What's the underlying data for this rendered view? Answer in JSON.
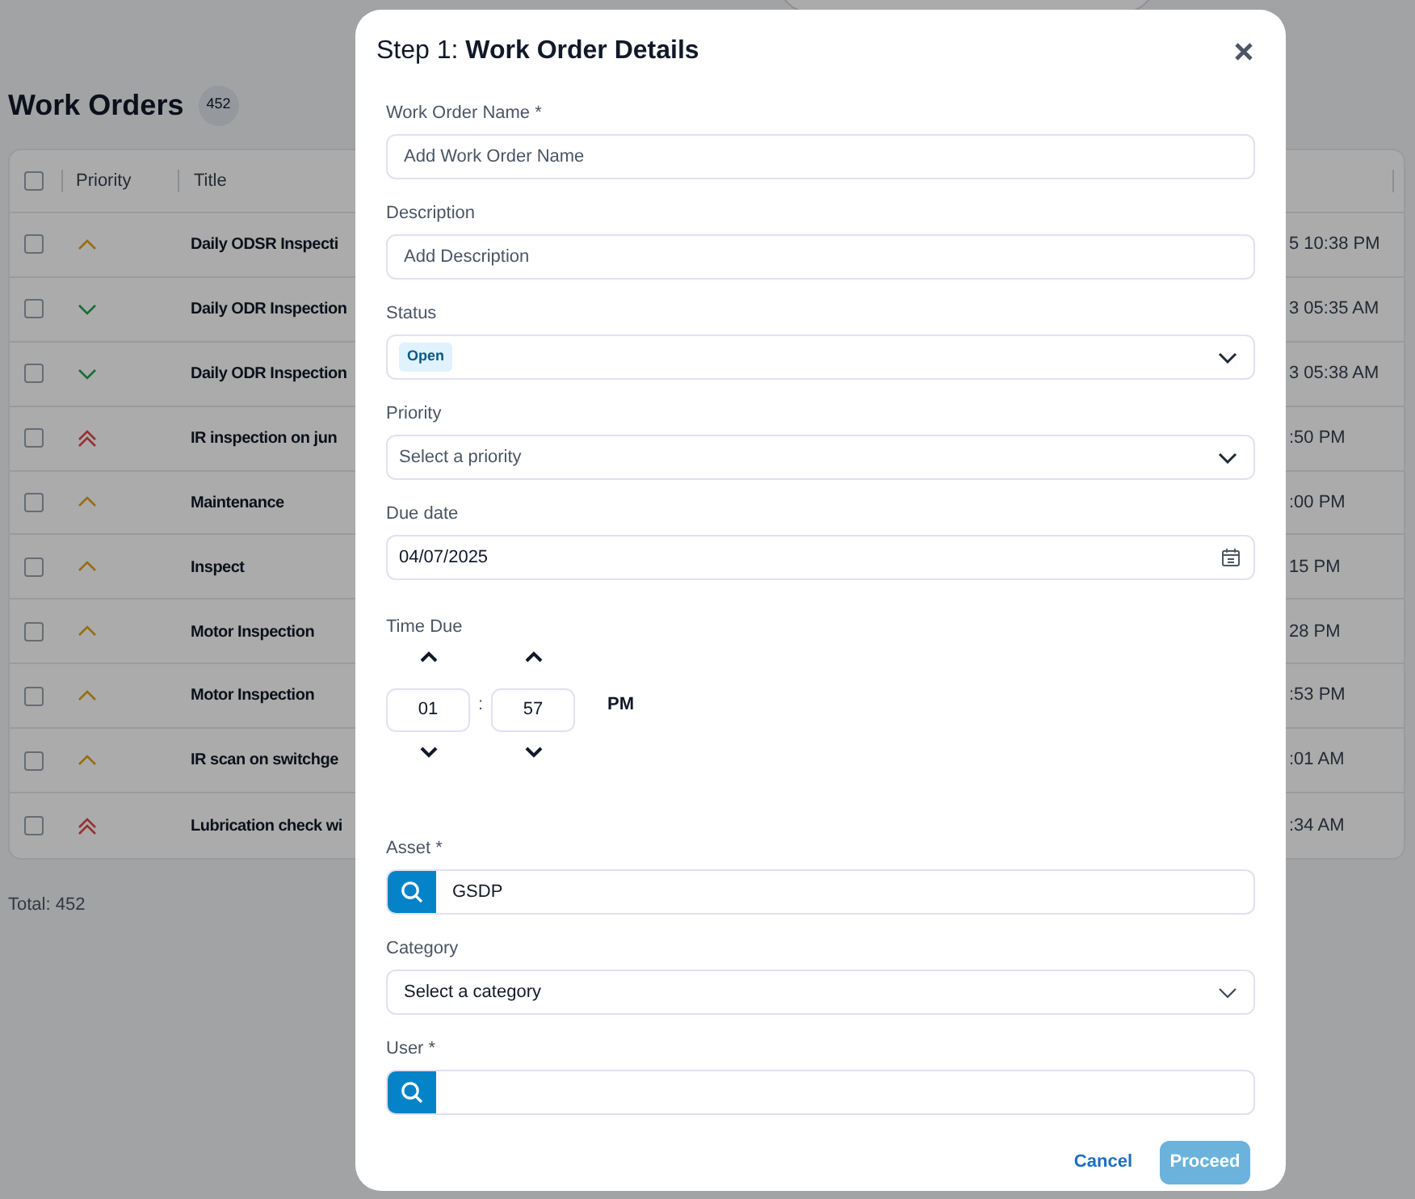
{
  "page": {
    "title": "Work Orders",
    "count": "452",
    "table": {
      "all_checked": false,
      "columns": [
        "Priority",
        "Title"
      ],
      "rows": [
        {
          "checked": false,
          "kind": "medium",
          "title": "Daily ODSR Inspecti",
          "column_3": "5 10:38 PM"
        },
        {
          "checked": false,
          "kind": "low",
          "title": "Daily ODR Inspection",
          "column_3": "3 05:35 AM"
        },
        {
          "checked": false,
          "kind": "low",
          "title": "Daily ODR Inspection",
          "column_3": "3 05:38 AM"
        },
        {
          "checked": false,
          "kind": "high",
          "title": "IR inspection on jun",
          "column_3": ":50 PM"
        },
        {
          "checked": false,
          "kind": "medium",
          "title": "Maintenance",
          "column_3": ":00 PM"
        },
        {
          "checked": false,
          "kind": "medium",
          "title": "Inspect",
          "column_3": "15 PM"
        },
        {
          "checked": false,
          "kind": "medium",
          "title": "Motor Inspection",
          "column_3": "28 PM"
        },
        {
          "checked": false,
          "kind": "medium",
          "title": "Motor Inspection",
          "column_3": ":53 PM"
        },
        {
          "checked": false,
          "kind": "medium",
          "title": "IR scan on switchge",
          "column_3": ":01 AM"
        },
        {
          "checked": false,
          "kind": "high",
          "title": "Lubrication check wi",
          "column_3": ":34 AM"
        }
      ]
    },
    "total": "Total: 452"
  },
  "dialog": {
    "title": "Step 1: **Work Order Details**",
    "fields": [
      {
        "kind": "text",
        "label": "Work Order Name *",
        "placeholder": "Add Work Order Name"
      },
      {
        "kind": "text",
        "label": "Description",
        "placeholder": "Add Description"
      },
      {
        "kind": "badge_select",
        "label": "Status",
        "value": "Open"
      },
      {
        "kind": "select",
        "label": "Priority",
        "placeholder": "Select a priority"
      },
      {
        "kind": "date",
        "label": "Due date",
        "value": "04/07/2025"
      },
      {
        "kind": "time",
        "label": "Time Due",
        "hour": "01",
        "separator": ":",
        "minute": "57",
        "period": "PM"
      },
      {
        "kind": "search",
        "label": "Asset *",
        "value": "GSDP"
      },
      {
        "kind": "select_dark",
        "label": "Category",
        "placeholder": "Select a category"
      },
      {
        "kind": "search",
        "label": "User *"
      }
    ],
    "buttons": [
      "Cancel",
      "Proceed"
    ]
  }
}
